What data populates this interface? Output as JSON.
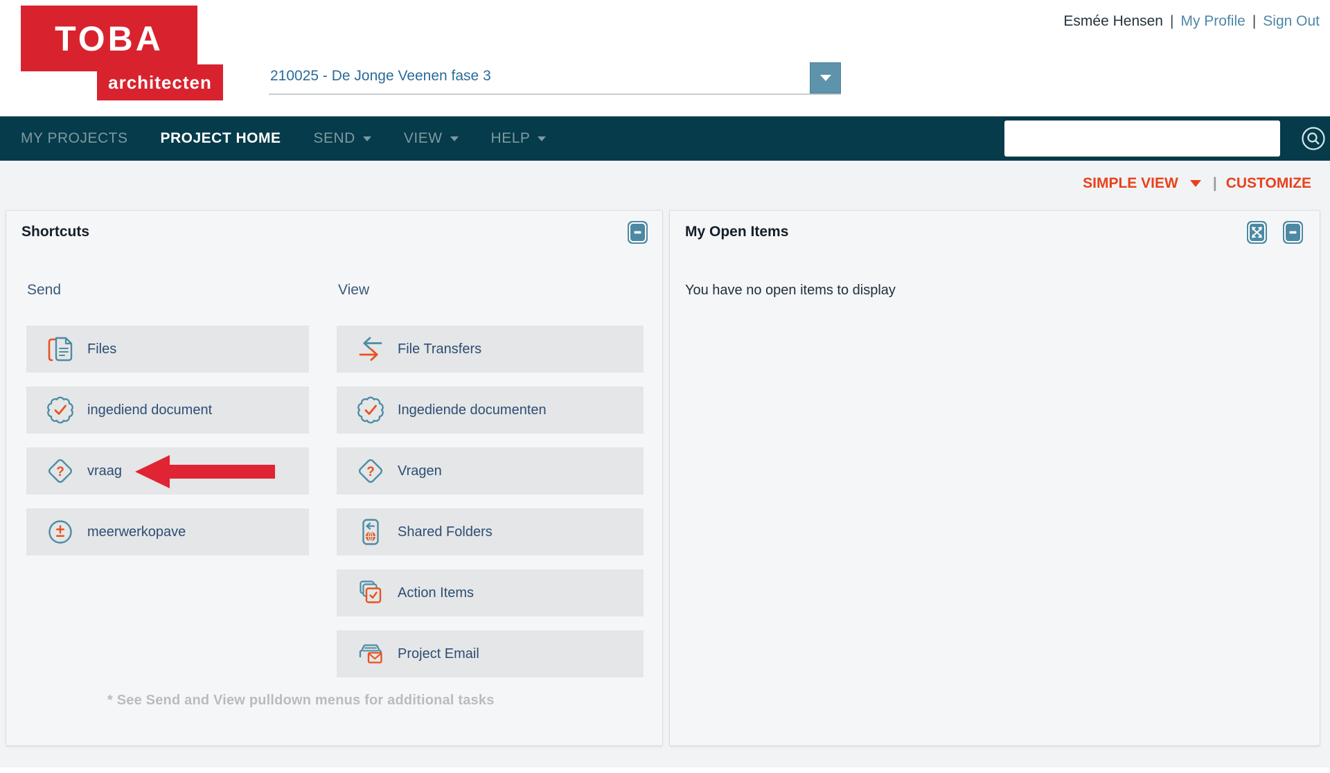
{
  "header": {
    "logo_line1": "TOBA",
    "logo_line2": "architecten",
    "project_selector_value": "210025 - De Jonge Veenen fase 3",
    "user_name": "Esmée Hensen",
    "sep1": "|",
    "my_profile": "My Profile",
    "sep2": "|",
    "sign_out": "Sign Out"
  },
  "nav": {
    "my_projects": "MY PROJECTS",
    "project_home": "PROJECT HOME",
    "send": "SEND",
    "view": "VIEW",
    "help": "HELP",
    "search_value": ""
  },
  "toolbar": {
    "view_mode_label": "SIMPLE VIEW",
    "separator": "|",
    "customize_label": "CUSTOMIZE"
  },
  "shortcuts_panel": {
    "title": "Shortcuts",
    "send_heading": "Send",
    "view_heading": "View",
    "send_items": [
      {
        "label": "Files",
        "icon": "files-icon"
      },
      {
        "label": "ingediend document",
        "icon": "seal-check-icon"
      },
      {
        "label": "vraag",
        "icon": "question-diamond-icon",
        "pointed_at_by_red_arrow": true
      },
      {
        "label": "meerwerkopave",
        "icon": "plus-minus-circle-icon"
      }
    ],
    "view_items": [
      {
        "label": "File Transfers",
        "icon": "transfer-arrows-icon"
      },
      {
        "label": "Ingediende documenten",
        "icon": "seal-check-icon"
      },
      {
        "label": "Vragen",
        "icon": "question-diamond-icon"
      },
      {
        "label": "Shared Folders",
        "icon": "shared-folder-icon"
      },
      {
        "label": "Action Items",
        "icon": "action-items-icon"
      },
      {
        "label": "Project Email",
        "icon": "project-email-icon"
      }
    ],
    "footnote": "* See Send and View pulldown menus for additional tasks"
  },
  "open_items_panel": {
    "title": "My Open Items",
    "empty_message": "You have no open items to display"
  },
  "colors": {
    "logo_red": "#d8232e",
    "nav_background": "#053b4a",
    "nav_inactive_text": "#7f99a2",
    "accent_teal": "#4e8ba5",
    "accent_orange": "#e8521f",
    "action_link_orange": "#e8411c",
    "link_blue": "#4d87a9",
    "project_value_blue": "#2a6b9c",
    "label_navy": "#2d4d74",
    "tile_gray": "#e4e6e7",
    "page_gray": "#f1f3f5",
    "arrow_red": "#e02433"
  }
}
